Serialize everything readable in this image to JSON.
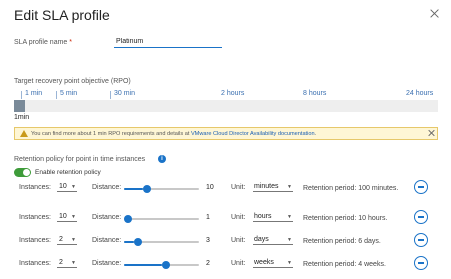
{
  "dialog": {
    "title": "Edit SLA profile"
  },
  "form": {
    "name_label": "SLA profile name",
    "required_marker": "*",
    "name_value": "Platinum"
  },
  "rpo": {
    "heading": "Target recovery point objective (RPO)",
    "ticks": [
      "1 min",
      "5 min",
      "30 min",
      "2 hours",
      "8 hours",
      "24 hours"
    ],
    "selected_label": "1min",
    "selected_fraction": 0.025
  },
  "alert": {
    "text_before": "You can find more about 1 min RPO requirements and details at",
    "link_text": "VMware Cloud Director Availability documentation",
    "text_after": ".",
    "accent_color": "#e6c86a"
  },
  "retention": {
    "heading": "Retention policy for point in time instances",
    "toggle_label": "Enable retention policy",
    "toggle_on": true,
    "instances_label": "Instances:",
    "distance_label": "Distance:",
    "unit_label": "Unit:",
    "rows": [
      {
        "instances": "10",
        "distance": "10",
        "distance_fraction": 0.25,
        "unit": "minutes",
        "period": "Retention period: 100 minutes."
      },
      {
        "instances": "10",
        "distance": "1",
        "distance_fraction": 0.0,
        "unit": "hours",
        "period": "Retention period: 10 hours."
      },
      {
        "instances": "2",
        "distance": "3",
        "distance_fraction": 0.13,
        "unit": "days",
        "period": "Retention period: 6 days."
      },
      {
        "instances": "2",
        "distance": "2",
        "distance_fraction": 0.5,
        "unit": "weeks",
        "period": "Retention period: 4 weeks."
      }
    ]
  },
  "colors": {
    "accent": "#1a73c8",
    "toggle_on": "#3e9c3a",
    "required": "#c92100"
  }
}
